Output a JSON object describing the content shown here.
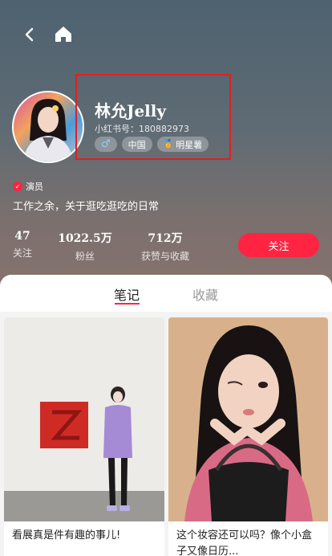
{
  "profile": {
    "name": "林允Jelly",
    "xhs_id": "小红书号：180882973",
    "tags": {
      "gender": "♂",
      "region": "中国",
      "star": "明星薯"
    },
    "verified_label": "演员",
    "bio": "工作之余，关于逛吃逛吃的日常",
    "follow_label": "关注"
  },
  "stats": [
    {
      "value": "47",
      "label": "关注"
    },
    {
      "value": "1022.5万",
      "label": "粉丝"
    },
    {
      "value": "712万",
      "label": "获赞与收藏"
    }
  ],
  "tabs": [
    {
      "label": "笔记",
      "active": true
    },
    {
      "label": "收藏",
      "active": false
    }
  ],
  "notes": [
    {
      "title": "看展真是件有趣的事儿!"
    },
    {
      "title": "这个妆容还可以吗？像个小盒子又像日历..."
    }
  ],
  "colors": {
    "accent": "#ff2442",
    "highlight_box": "#e02020"
  },
  "icons": {
    "back": "chevron-left-icon",
    "home": "home-icon",
    "medal": "medal-icon",
    "verified": "check-icon"
  }
}
